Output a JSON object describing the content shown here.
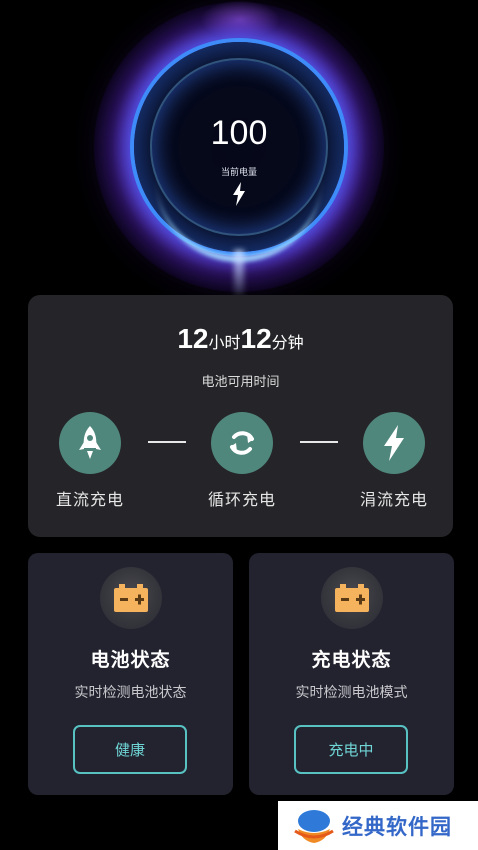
{
  "battery": {
    "level": "100",
    "level_label": "当前电量",
    "status_icon": "lightning-bolt-icon"
  },
  "remaining": {
    "hours": "12",
    "hours_unit": "小时",
    "minutes": "12",
    "minutes_unit": "分钟",
    "caption": "电池可用时间"
  },
  "charge_modes": [
    {
      "label": "直流充电",
      "icon": "rocket-icon"
    },
    {
      "label": "循环充电",
      "icon": "refresh-cycle-icon"
    },
    {
      "label": "涓流充电",
      "icon": "lightning-bolt-icon"
    }
  ],
  "cards": [
    {
      "title": "电池状态",
      "subtitle": "实时检测电池状态",
      "button": "健康",
      "icon": "battery-icon"
    },
    {
      "title": "充电状态",
      "subtitle": "实时检测电池模式",
      "button": "充电中",
      "icon": "battery-icon"
    }
  ],
  "watermark": {
    "text": "经典软件园"
  },
  "colors": {
    "accent_teal": "#4f877c",
    "button_border": "#58c2c2",
    "battery_orange": "#f4b35c",
    "card_bg": "#252529"
  }
}
